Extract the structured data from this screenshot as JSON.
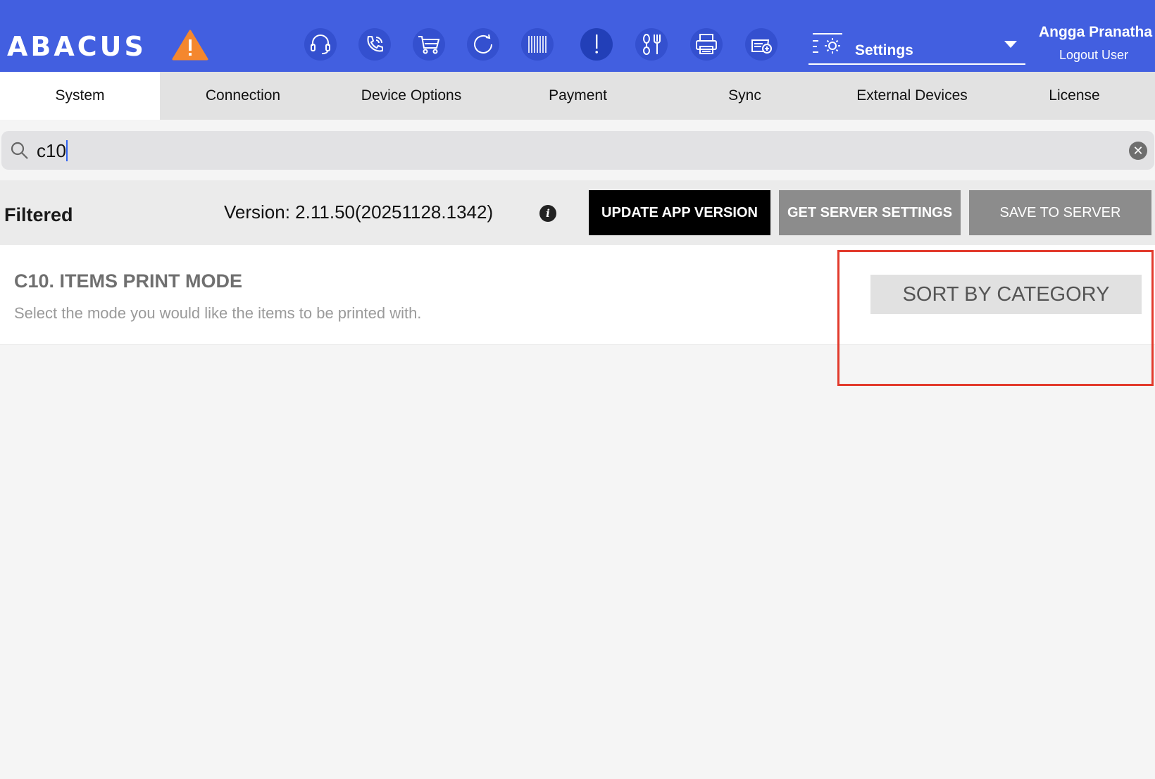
{
  "header": {
    "logo": "ABACUS",
    "settings_label": "Settings",
    "user_name": "Angga Pranatha",
    "logout_label": "Logout User",
    "colors": {
      "header_bg": "#425fe0",
      "warning": "#f4872e"
    },
    "icons": [
      "headset-icon",
      "phone-icon",
      "cart-icon",
      "refresh-icon",
      "barcode-icon",
      "alert-icon",
      "kitchen-tools-icon",
      "printer-icon",
      "add-device-icon"
    ]
  },
  "tabs": [
    {
      "label": "System",
      "active": true
    },
    {
      "label": "Connection"
    },
    {
      "label": "Device Options"
    },
    {
      "label": "Payment"
    },
    {
      "label": "Sync"
    },
    {
      "label": "External Devices"
    },
    {
      "label": "License"
    }
  ],
  "search": {
    "value": "c10"
  },
  "toolbar": {
    "filtered_label": "Filtered",
    "version_text": "Version: 2.11.50(20251128.1342)",
    "update_button": "UPDATE APP VERSION",
    "get_server_button": "GET SERVER SETTINGS",
    "save_server_button": "SAVE TO SERVER"
  },
  "setting": {
    "title": "C10. ITEMS PRINT MODE",
    "description": "Select the mode you would like the items to be printed with.",
    "value": "SORT BY CATEGORY"
  }
}
